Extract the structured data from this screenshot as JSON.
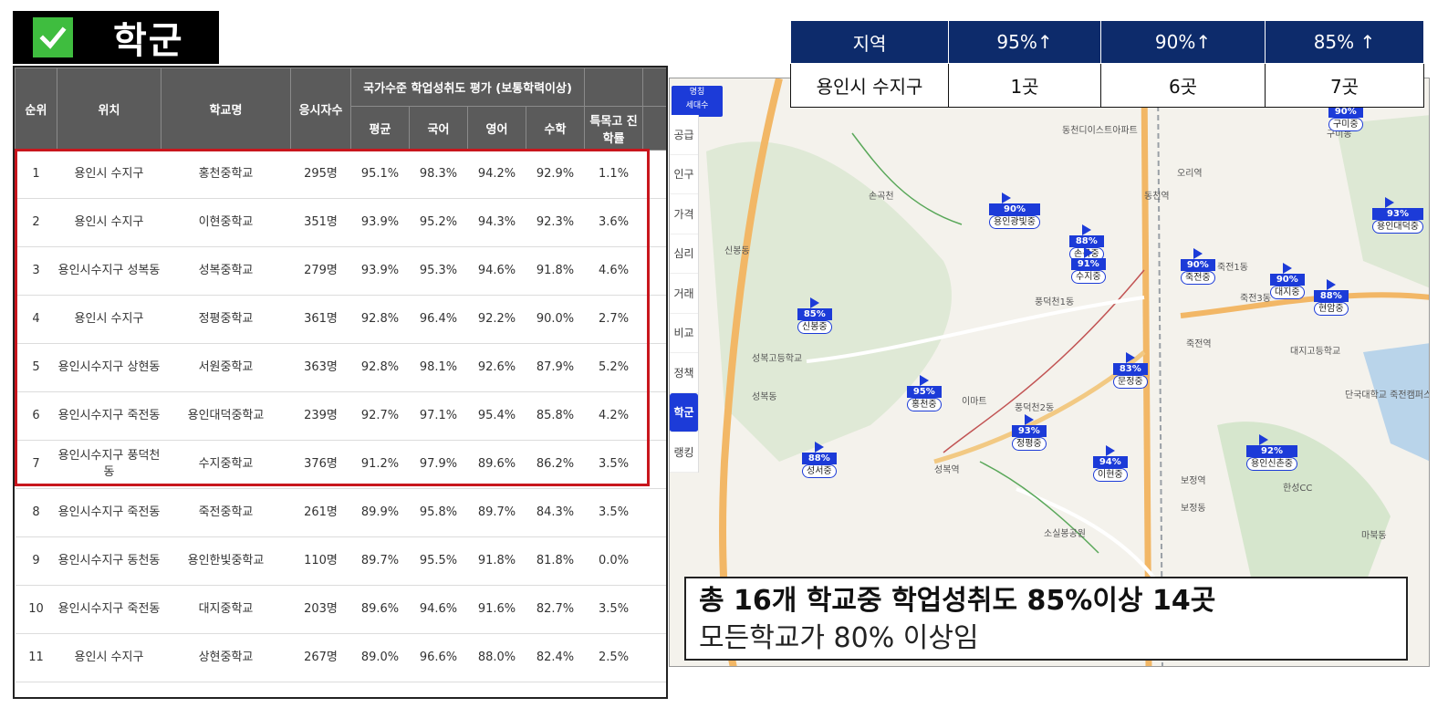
{
  "header": {
    "title": "학군",
    "check_icon": "check-icon"
  },
  "colors": {
    "header_bg": "#5b5b5b",
    "highlight": "#c8161d",
    "stats_header": "#0d2b6b",
    "flag": "#1c3bd8",
    "check": "#3fbd3f"
  },
  "table": {
    "headers": {
      "rank": "순위",
      "location": "위치",
      "school": "학교명",
      "examinees": "응시자수",
      "group": "국가수준 학업성취도 평가 (보통학력이상)",
      "avg": "평균",
      "korean": "국어",
      "english": "영어",
      "math": "수학",
      "special": "특목고 진학률"
    },
    "rows": [
      {
        "rank": "1",
        "location": "용인시 수지구",
        "school": "홍천중학교",
        "examinees": "295명",
        "avg": "95.1%",
        "korean": "98.3%",
        "english": "94.2%",
        "math": "92.9%",
        "special": "1.1%"
      },
      {
        "rank": "2",
        "location": "용인시 수지구",
        "school": "이현중학교",
        "examinees": "351명",
        "avg": "93.9%",
        "korean": "95.2%",
        "english": "94.3%",
        "math": "92.3%",
        "special": "3.6%"
      },
      {
        "rank": "3",
        "location": "용인시수지구 성복동",
        "school": "성복중학교",
        "examinees": "279명",
        "avg": "93.9%",
        "korean": "95.3%",
        "english": "94.6%",
        "math": "91.8%",
        "special": "4.6%"
      },
      {
        "rank": "4",
        "location": "용인시 수지구",
        "school": "정평중학교",
        "examinees": "361명",
        "avg": "92.8%",
        "korean": "96.4%",
        "english": "92.2%",
        "math": "90.0%",
        "special": "2.7%"
      },
      {
        "rank": "5",
        "location": "용인시수지구 상현동",
        "school": "서원중학교",
        "examinees": "363명",
        "avg": "92.8%",
        "korean": "98.1%",
        "english": "92.6%",
        "math": "87.9%",
        "special": "5.2%"
      },
      {
        "rank": "6",
        "location": "용인시수지구 죽전동",
        "school": "용인대덕중학교",
        "examinees": "239명",
        "avg": "92.7%",
        "korean": "97.1%",
        "english": "95.4%",
        "math": "85.8%",
        "special": "4.2%"
      },
      {
        "rank": "7",
        "location": "용인시수지구 풍덕천동",
        "school": "수지중학교",
        "examinees": "376명",
        "avg": "91.2%",
        "korean": "97.9%",
        "english": "89.6%",
        "math": "86.2%",
        "special": "3.5%"
      },
      {
        "rank": "8",
        "location": "용인시수지구 죽전동",
        "school": "죽전중학교",
        "examinees": "261명",
        "avg": "89.9%",
        "korean": "95.8%",
        "english": "89.7%",
        "math": "84.3%",
        "special": "3.5%"
      },
      {
        "rank": "9",
        "location": "용인시수지구 동천동",
        "school": "용인한빛중학교",
        "examinees": "110명",
        "avg": "89.7%",
        "korean": "95.5%",
        "english": "91.8%",
        "math": "81.8%",
        "special": "0.0%"
      },
      {
        "rank": "10",
        "location": "용인시수지구 죽전동",
        "school": "대지중학교",
        "examinees": "203명",
        "avg": "89.6%",
        "korean": "94.6%",
        "english": "91.6%",
        "math": "82.7%",
        "special": "3.5%"
      },
      {
        "rank": "11",
        "location": "용인시 수지구",
        "school": "상현중학교",
        "examinees": "267명",
        "avg": "89.0%",
        "korean": "96.6%",
        "english": "88.0%",
        "math": "82.4%",
        "special": "2.5%"
      }
    ]
  },
  "stats": {
    "headers": [
      "지역",
      "95%↑",
      "90%↑",
      "85% ↑"
    ],
    "row": [
      "용인시 수지구",
      "1곳",
      "6곳",
      "7곳"
    ]
  },
  "map": {
    "badge": [
      "명칭",
      "세대수"
    ],
    "tabs": [
      "공급",
      "인구",
      "가격",
      "심리",
      "거래",
      "비교",
      "정책",
      "학군",
      "랭킹"
    ],
    "active_tab": "학군",
    "pins": [
      {
        "pct": "90%",
        "name": "용인광빛중"
      },
      {
        "pct": "88%",
        "name": "손곡중"
      },
      {
        "pct": "91%",
        "name": "수지중"
      },
      {
        "pct": "90%",
        "name": "죽전중"
      },
      {
        "pct": "90%",
        "name": "대지중"
      },
      {
        "pct": "88%",
        "name": "현암중"
      },
      {
        "pct": "93%",
        "name": "용인대덕중"
      },
      {
        "pct": "85%",
        "name": "신봉중"
      },
      {
        "pct": "95%",
        "name": "홍천중"
      },
      {
        "pct": "83%",
        "name": "문정중"
      },
      {
        "pct": "93%",
        "name": "정평중"
      },
      {
        "pct": "88%",
        "name": "성서중"
      },
      {
        "pct": "94%",
        "name": "이현중"
      },
      {
        "pct": "92%",
        "name": "용인신촌중"
      },
      {
        "pct": "90%",
        "name": "구미중"
      }
    ],
    "labels": [
      "동천디이스트아파트",
      "오리역",
      "동천역",
      "손곡천",
      "신봉동",
      "풍덕천1동",
      "죽전1동",
      "죽전3동",
      "죽전역",
      "성복동",
      "성복역",
      "풍덕천2동",
      "보정역",
      "보정동",
      "마북동",
      "단국대학교 죽전캠퍼스",
      "대지고등학교",
      "이마트",
      "소실봉공원",
      "구미동",
      "성복고등학교",
      "한성CC"
    ]
  },
  "summary": {
    "line1": "총 16개 학교중 학업성취도 85%이상 14곳",
    "line2": "모든학교가 80% 이상임"
  }
}
